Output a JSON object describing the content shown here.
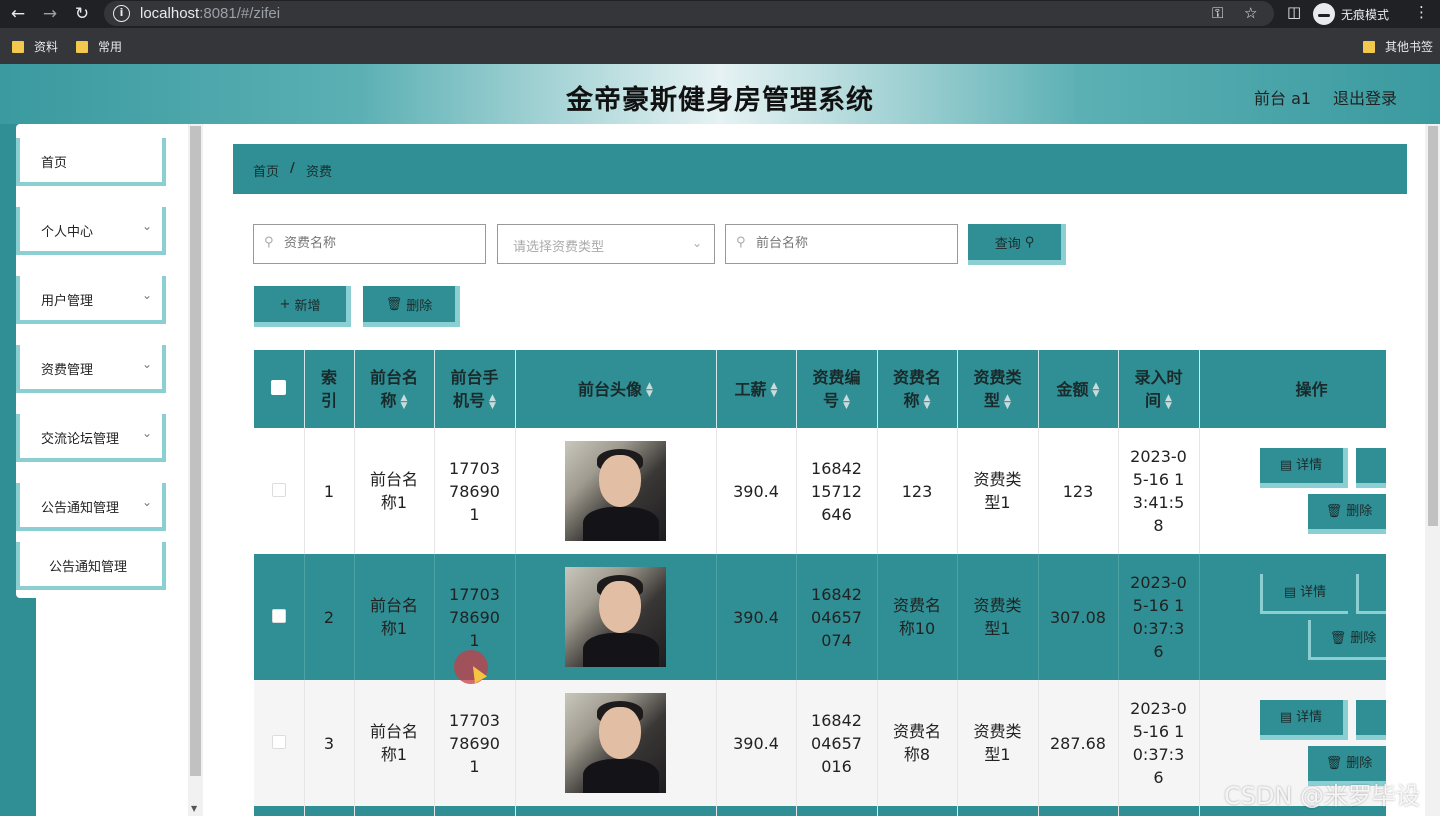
{
  "browser": {
    "url_host": "localhost",
    "url_rest": ":8081/#/zifei",
    "incognito_label": "无痕模式",
    "bookmarks": [
      "资料",
      "常用"
    ],
    "other_bookmarks": "其他书签"
  },
  "header": {
    "title": "金帝豪斯健身房管理系统",
    "user": "前台 a1",
    "logout": "退出登录"
  },
  "sidebar": {
    "items": [
      {
        "label": "首页"
      },
      {
        "label": "个人中心"
      },
      {
        "label": "用户管理"
      },
      {
        "label": "资费管理"
      },
      {
        "label": "交流论坛管理"
      },
      {
        "label": "公告通知管理"
      }
    ],
    "open_sub_item": "公告通知管理"
  },
  "breadcrumb": {
    "home": "首页",
    "separator": "/",
    "current": "资费"
  },
  "search": {
    "name_placeholder": "资费名称",
    "type_placeholder": "请选择资费类型",
    "front_placeholder": "前台名称",
    "query_label": "查询"
  },
  "actions": {
    "add_label": "新增",
    "delete_label": "删除"
  },
  "table": {
    "headers": {
      "index": "索引",
      "front_name": "前台名称",
      "front_phone": "前台手机号",
      "avatar": "前台头像",
      "salary": "工薪",
      "fee_code": "资费编号",
      "fee_name": "资费名称",
      "fee_type": "资费类型",
      "amount": "金额",
      "entry_time": "录入时间",
      "ops": "操作"
    },
    "rows": [
      {
        "index": "1",
        "front_name": "前台名称1",
        "front_phone": "17703786901",
        "salary": "390.4",
        "fee_code": "1684215712646",
        "fee_name": "123",
        "fee_type": "资费类型1",
        "amount": "123",
        "entry_time": "2023-05-16 13:41:58"
      },
      {
        "index": "2",
        "front_name": "前台名称1",
        "front_phone": "17703786901",
        "salary": "390.4",
        "fee_code": "1684204657074",
        "fee_name": "资费名称10",
        "fee_type": "资费类型1",
        "amount": "307.08",
        "entry_time": "2023-05-16 10:37:36"
      },
      {
        "index": "3",
        "front_name": "前台名称1",
        "front_phone": "17703786901",
        "salary": "390.4",
        "fee_code": "1684204657016",
        "fee_name": "资费名称8",
        "fee_type": "资费类型1",
        "amount": "287.68",
        "entry_time": "2023-05-16 10:37:36"
      }
    ],
    "detail_label": "详情",
    "row_delete_label": "删除"
  },
  "watermark": "CSDN @米罗毕设"
}
